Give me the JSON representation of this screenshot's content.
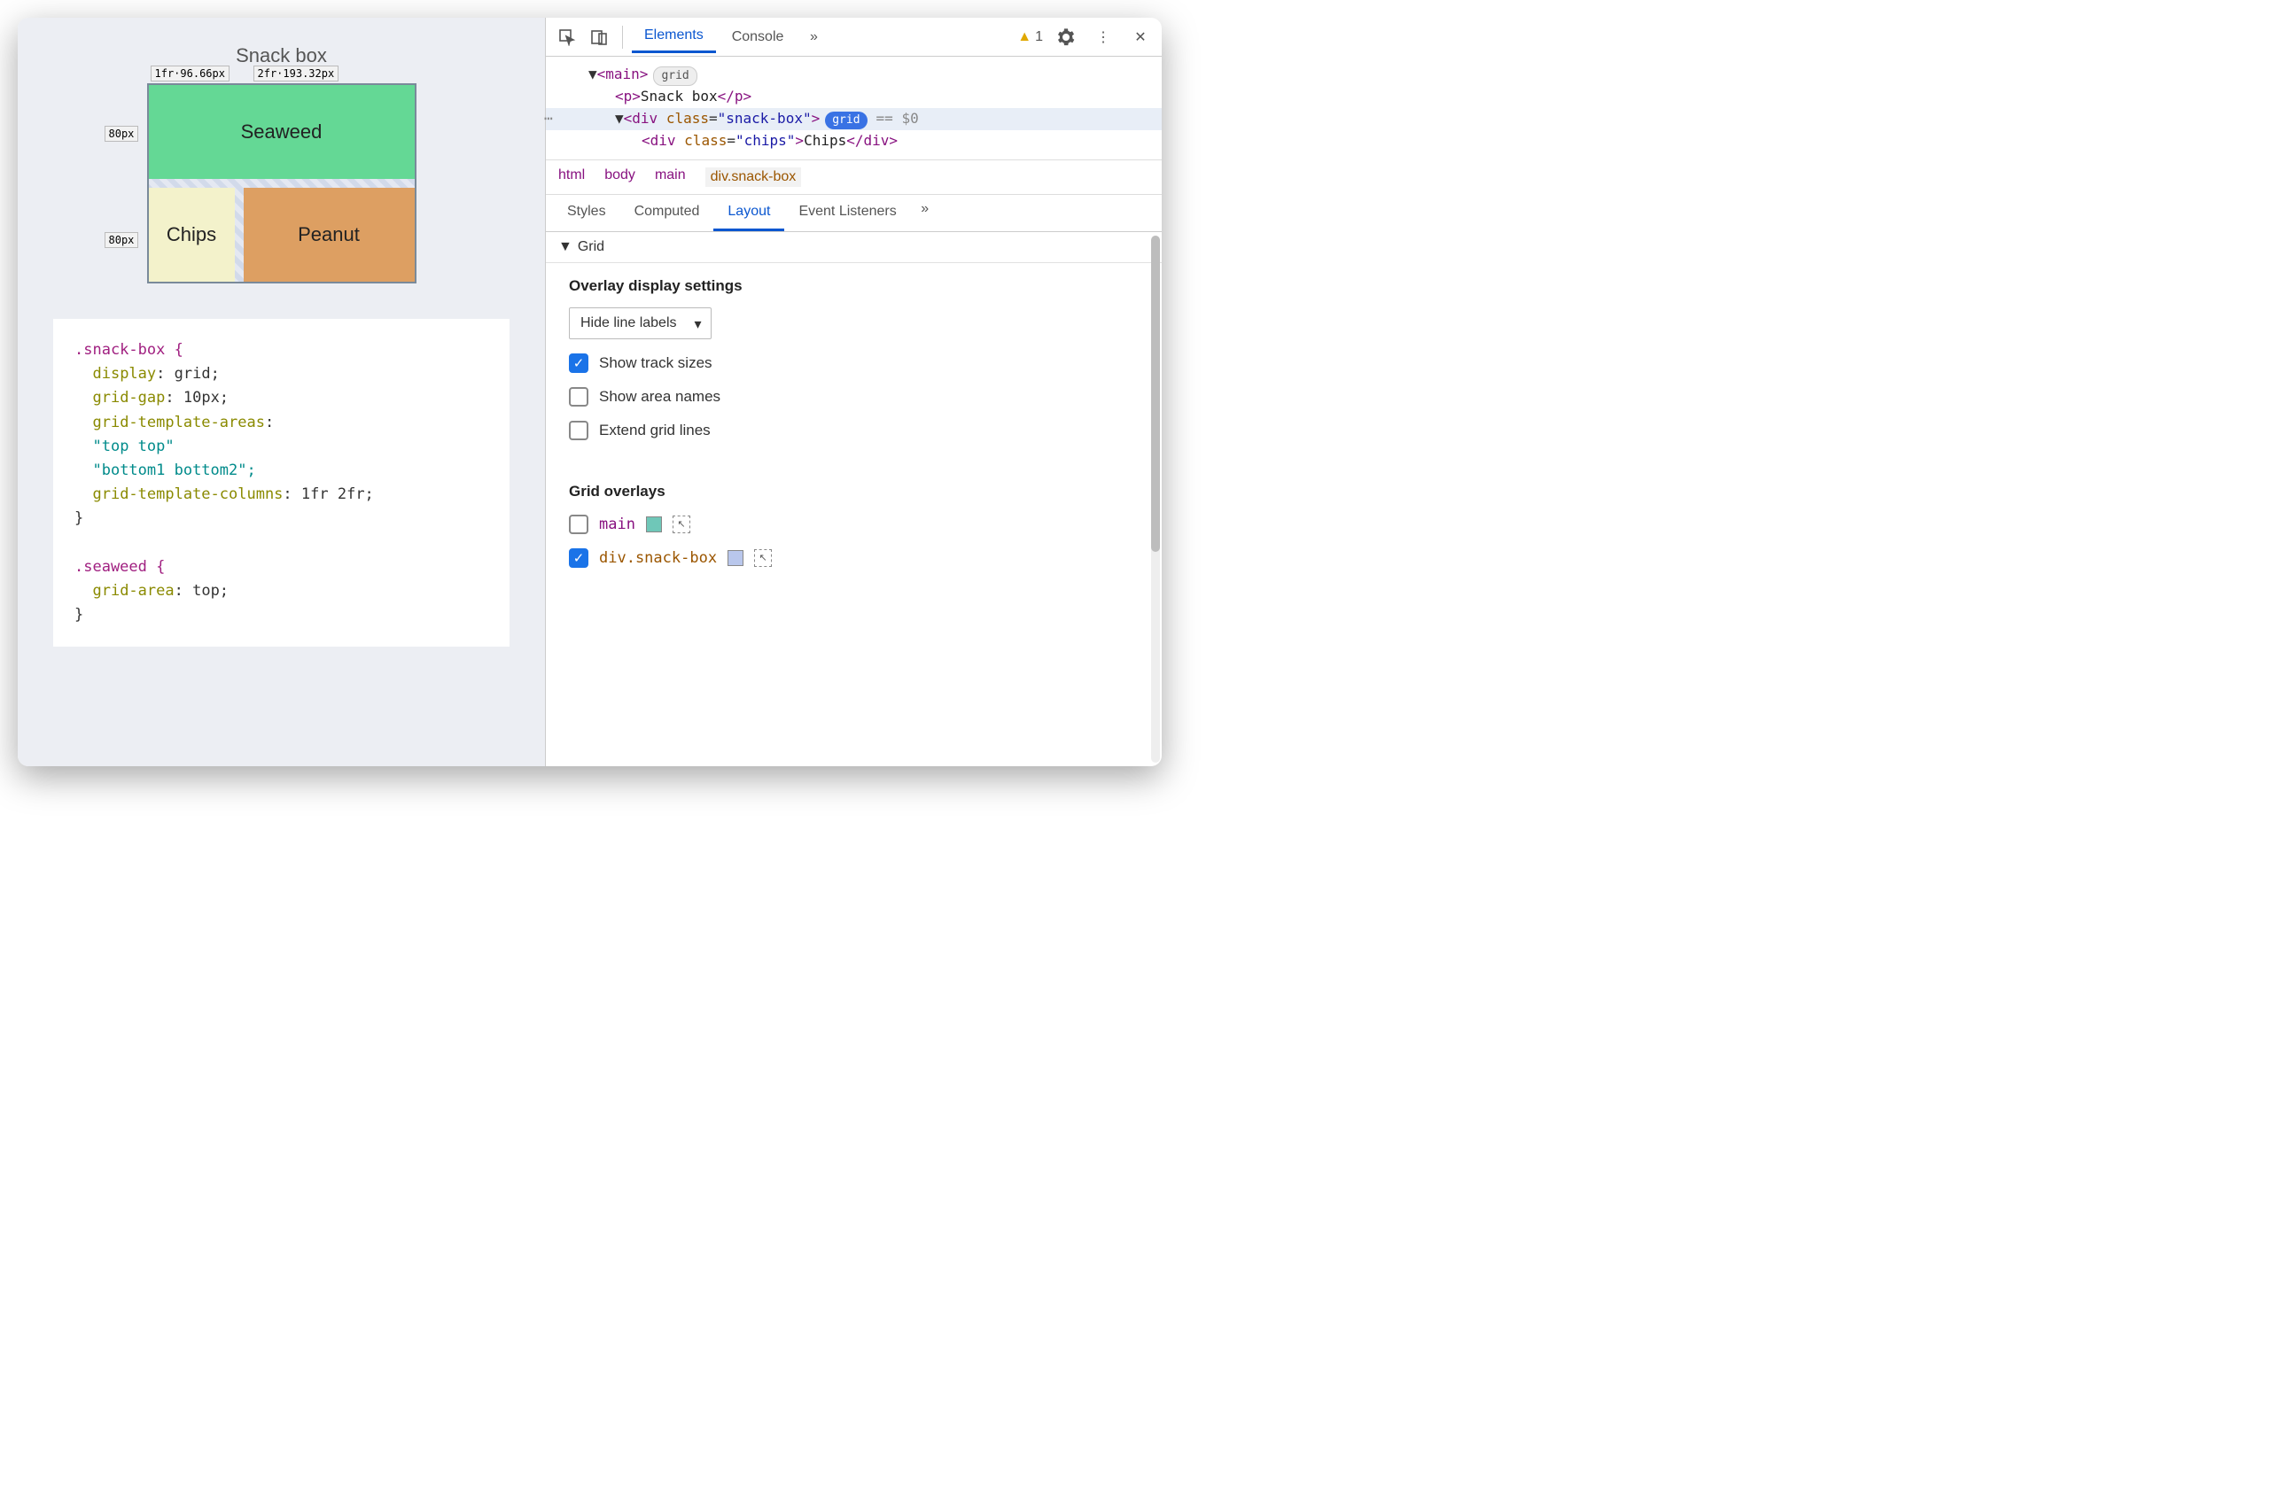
{
  "viewport": {
    "title": "Snack box",
    "cells": {
      "seaweed": "Seaweed",
      "chips": "Chips",
      "peanut": "Peanut"
    },
    "track_labels": {
      "col1": "1fr·96.66px",
      "col2": "2fr·193.32px",
      "row1": "80px",
      "row2": "80px"
    }
  },
  "css": {
    "line1": ".snack-box {",
    "line2_prop": "display",
    "line2_val": "grid;",
    "line3_prop": "grid-gap",
    "line3_val": "10px;",
    "line4_prop": "grid-template-areas",
    "line4_colon": ":",
    "line5": "\"top top\"",
    "line6": "\"bottom1 bottom2\";",
    "line7_prop": "grid-template-columns",
    "line7_val": "1fr 2fr;",
    "line8": "}",
    "line10": ".seaweed {",
    "line11_prop": "grid-area",
    "line11_val": "top;",
    "line12": "}"
  },
  "toolbar": {
    "tabs": {
      "elements": "Elements",
      "console": "Console"
    },
    "warning_count": "1"
  },
  "dom": {
    "main_open": "<main>",
    "main_pill": "grid",
    "p_open": "<p>",
    "p_text": "Snack box",
    "p_close": "</p>",
    "sel_open": "<div",
    "sel_attr": "class",
    "sel_val": "\"snack-box\"",
    "sel_close": ">",
    "sel_pill": "grid",
    "sel_eq": "== $0",
    "chips_line": "<div class=\"chips\">Chips</div>"
  },
  "breadcrumb": [
    "html",
    "body",
    "main",
    "div.snack-box"
  ],
  "subtabs": {
    "styles": "Styles",
    "computed": "Computed",
    "layout": "Layout",
    "listeners": "Event Listeners"
  },
  "layout_panel": {
    "section": "Grid",
    "overlay_heading": "Overlay display settings",
    "select": "Hide line labels",
    "check_track": "Show track sizes",
    "check_area": "Show area names",
    "check_extend": "Extend grid lines",
    "overlays_heading": "Grid overlays",
    "overlay_main": "main",
    "overlay_snack": "div.snack-box",
    "swatch_main": "#6fc7b8",
    "swatch_snack": "#b9c7ec"
  }
}
